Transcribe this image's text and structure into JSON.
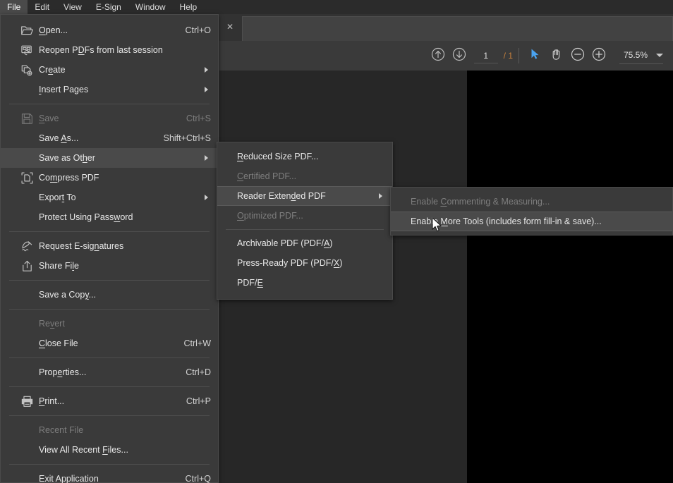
{
  "menubar": {
    "items": [
      {
        "label": "File",
        "active": true
      },
      {
        "label": "Edit",
        "active": false
      },
      {
        "label": "View",
        "active": false
      },
      {
        "label": "E-Sign",
        "active": false
      },
      {
        "label": "Window",
        "active": false
      },
      {
        "label": "Help",
        "active": false
      }
    ]
  },
  "tabbar": {
    "close_label": "✕"
  },
  "toolbar": {
    "prev_page_icon": "arrow-up-circle-icon",
    "next_page_icon": "arrow-down-circle-icon",
    "page_number": "1",
    "page_total": "/ 1",
    "select_tool_icon": "cursor-arrow-icon",
    "hand_tool_icon": "hand-icon",
    "zoom_out_icon": "minus-circle-icon",
    "zoom_in_icon": "plus-circle-icon",
    "zoom_level": "75.5%",
    "zoom_dropdown_icon": "chevron-down-icon"
  },
  "file_menu": {
    "items": [
      {
        "kind": "item",
        "name": "open",
        "icon": "folder-open-icon",
        "pre": "",
        "acc": "O",
        "post": "pen...",
        "accel": "Ctrl+O",
        "disabled": false,
        "submenu": false,
        "highlight": false
      },
      {
        "kind": "item",
        "name": "reopen-pdfs",
        "icon": "reopen-pdf-icon",
        "pre": "Reopen P",
        "acc": "D",
        "post": "Fs from last session",
        "accel": "",
        "disabled": false,
        "submenu": false,
        "highlight": false
      },
      {
        "kind": "item",
        "name": "create",
        "icon": "create-pdf-icon",
        "pre": "Cr",
        "acc": "e",
        "post": "ate",
        "accel": "",
        "disabled": false,
        "submenu": true,
        "highlight": false
      },
      {
        "kind": "item",
        "name": "insert-pages",
        "icon": "",
        "pre": "",
        "acc": "I",
        "post": "nsert Pages",
        "accel": "",
        "disabled": false,
        "submenu": true,
        "highlight": false
      },
      {
        "kind": "sep",
        "name": "separator-1"
      },
      {
        "kind": "item",
        "name": "save",
        "icon": "save-disk-icon",
        "pre": "",
        "acc": "S",
        "post": "ave",
        "accel": "Ctrl+S",
        "disabled": true,
        "submenu": false,
        "highlight": false
      },
      {
        "kind": "item",
        "name": "save-as",
        "icon": "",
        "pre": "Save ",
        "acc": "A",
        "post": "s...",
        "accel": "Shift+Ctrl+S",
        "disabled": false,
        "submenu": false,
        "highlight": false
      },
      {
        "kind": "item",
        "name": "save-as-other",
        "icon": "",
        "pre": "Save as Ot",
        "acc": "h",
        "post": "er",
        "accel": "",
        "disabled": false,
        "submenu": true,
        "highlight": true
      },
      {
        "kind": "item",
        "name": "compress-pdf",
        "icon": "compress-pdf-icon",
        "pre": "Co",
        "acc": "m",
        "post": "press PDF",
        "accel": "",
        "disabled": false,
        "submenu": false,
        "highlight": false
      },
      {
        "kind": "item",
        "name": "export-to",
        "icon": "",
        "pre": "Expor",
        "acc": "t",
        "post": " To",
        "accel": "",
        "disabled": false,
        "submenu": true,
        "highlight": false
      },
      {
        "kind": "item",
        "name": "protect-using-password",
        "icon": "",
        "pre": "Protect Using Pass",
        "acc": "w",
        "post": "ord",
        "accel": "",
        "disabled": false,
        "submenu": false,
        "highlight": false
      },
      {
        "kind": "sep",
        "name": "separator-2"
      },
      {
        "kind": "item",
        "name": "request-e-signatures",
        "icon": "e-signature-icon",
        "pre": "Request E-sig",
        "acc": "n",
        "post": "atures",
        "accel": "",
        "disabled": false,
        "submenu": false,
        "highlight": false
      },
      {
        "kind": "item",
        "name": "share-file",
        "icon": "share-icon",
        "pre": "Share Fi",
        "acc": "l",
        "post": "e",
        "accel": "",
        "disabled": false,
        "submenu": false,
        "highlight": false
      },
      {
        "kind": "sep",
        "name": "separator-3"
      },
      {
        "kind": "item",
        "name": "save-a-copy",
        "icon": "",
        "pre": "Save a Cop",
        "acc": "y",
        "post": "...",
        "accel": "",
        "disabled": false,
        "submenu": false,
        "highlight": false
      },
      {
        "kind": "sep",
        "name": "separator-4"
      },
      {
        "kind": "item",
        "name": "revert",
        "icon": "",
        "pre": "Re",
        "acc": "v",
        "post": "ert",
        "accel": "",
        "disabled": true,
        "submenu": false,
        "highlight": false
      },
      {
        "kind": "item",
        "name": "close-file",
        "icon": "",
        "pre": "",
        "acc": "C",
        "post": "lose File",
        "accel": "Ctrl+W",
        "disabled": false,
        "submenu": false,
        "highlight": false
      },
      {
        "kind": "sep",
        "name": "separator-5"
      },
      {
        "kind": "item",
        "name": "properties",
        "icon": "",
        "pre": "Prop",
        "acc": "e",
        "post": "rties...",
        "accel": "Ctrl+D",
        "disabled": false,
        "submenu": false,
        "highlight": false
      },
      {
        "kind": "sep",
        "name": "separator-6"
      },
      {
        "kind": "item",
        "name": "print",
        "icon": "printer-icon",
        "pre": "",
        "acc": "P",
        "post": "rint...",
        "accel": "Ctrl+P",
        "disabled": false,
        "submenu": false,
        "highlight": false
      },
      {
        "kind": "sep",
        "name": "separator-7"
      },
      {
        "kind": "item",
        "name": "recent-file",
        "icon": "",
        "pre": "Recent File",
        "acc": "",
        "post": "",
        "accel": "",
        "disabled": true,
        "submenu": false,
        "highlight": false
      },
      {
        "kind": "item",
        "name": "view-all-recent-files",
        "icon": "",
        "pre": "View All Recent ",
        "acc": "F",
        "post": "iles...",
        "accel": "",
        "disabled": false,
        "submenu": false,
        "highlight": false
      },
      {
        "kind": "sep",
        "name": "separator-8"
      },
      {
        "kind": "item",
        "name": "exit-application",
        "icon": "",
        "pre": "E",
        "acc": "x",
        "post": "it Application",
        "accel": "Ctrl+Q",
        "disabled": false,
        "submenu": false,
        "highlight": false
      }
    ]
  },
  "save_as_other_menu": {
    "items": [
      {
        "kind": "item",
        "name": "reduced-size-pdf",
        "pre": "",
        "acc": "R",
        "post": "educed Size PDF...",
        "disabled": false,
        "submenu": false,
        "highlight": false
      },
      {
        "kind": "item",
        "name": "certified-pdf",
        "pre": "",
        "acc": "C",
        "post": "ertified PDF...",
        "disabled": true,
        "submenu": false,
        "highlight": false
      },
      {
        "kind": "item",
        "name": "reader-extended-pdf",
        "pre": "Reader Exten",
        "acc": "d",
        "post": "ed PDF",
        "disabled": false,
        "submenu": true,
        "highlight": true
      },
      {
        "kind": "item",
        "name": "optimized-pdf",
        "pre": "",
        "acc": "O",
        "post": "ptimized PDF...",
        "disabled": true,
        "submenu": false,
        "highlight": false
      },
      {
        "kind": "sep",
        "name": "separator-1"
      },
      {
        "kind": "item",
        "name": "archivable-pdf",
        "pre": "Archivable PDF (PDF/",
        "acc": "A",
        "post": ")",
        "disabled": false,
        "submenu": false,
        "highlight": false
      },
      {
        "kind": "item",
        "name": "press-ready-pdf",
        "pre": "Press-Ready PDF (PDF/",
        "acc": "X",
        "post": ")",
        "disabled": false,
        "submenu": false,
        "highlight": false
      },
      {
        "kind": "item",
        "name": "pdf-e",
        "pre": "PDF/",
        "acc": "E",
        "post": "",
        "disabled": false,
        "submenu": false,
        "highlight": false
      }
    ]
  },
  "reader_extended_menu": {
    "items": [
      {
        "kind": "item",
        "name": "enable-commenting-measuring",
        "pre": "Enable ",
        "acc": "C",
        "post": "ommenting & Measuring...",
        "disabled": true,
        "submenu": false,
        "highlight": false
      },
      {
        "kind": "item",
        "name": "enable-more-tools",
        "pre": "Enable ",
        "acc": "M",
        "post": "ore Tools (includes form fill-in & save)...",
        "disabled": false,
        "submenu": false,
        "highlight": true
      }
    ]
  },
  "colors": {
    "menu_bg": "#3a3a3a",
    "menubar_bg": "#2b2b2b",
    "highlight": "#4a4a4a",
    "text": "#e8e8e8",
    "disabled_text": "#7d7d7d",
    "accent_blue": "#4aa3f0",
    "page_black": "#000000",
    "doc_bg": "#272727"
  }
}
